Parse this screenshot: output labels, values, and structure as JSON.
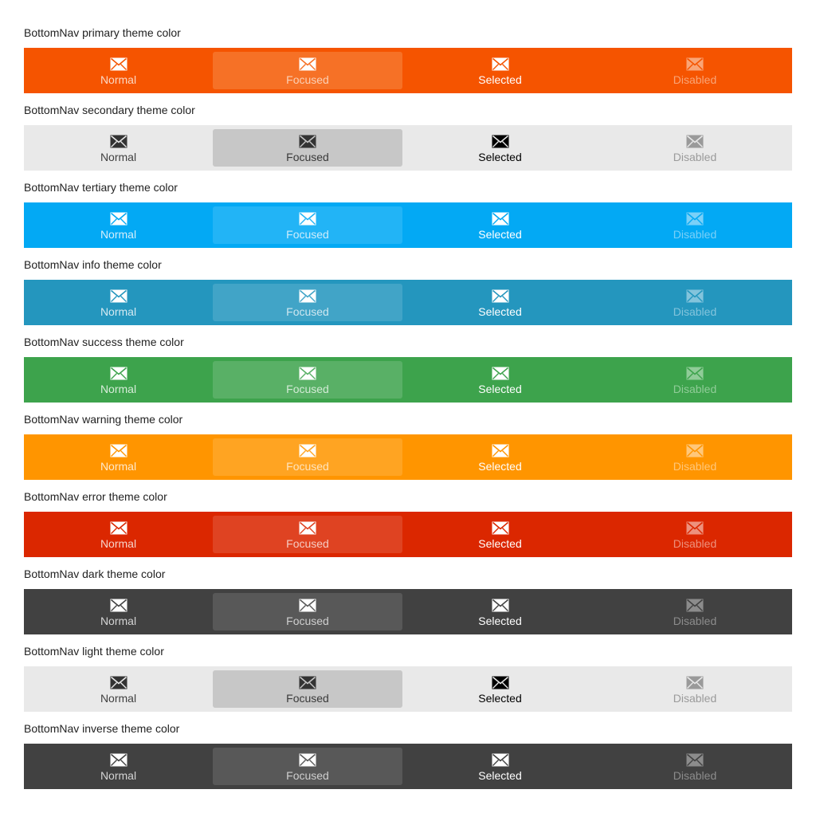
{
  "items": [
    {
      "label": "Normal",
      "state": "normal"
    },
    {
      "label": "Focused",
      "state": "focused"
    },
    {
      "label": "Selected",
      "state": "selected"
    },
    {
      "label": "Disabled",
      "state": "disabled"
    }
  ],
  "icon": "envelope-icon",
  "themes": [
    {
      "key": "primary",
      "title": "BottomNav primary theme color",
      "bg": "#f55400",
      "focus_bg": "#f67126",
      "normal_color": "#fbd8c3",
      "focused_color": "#fbd0b5",
      "selected_color": "#ffffff",
      "disabled_color": "#f9a577",
      "icon_normal": "#ffffff",
      "icon_disabled": "#f9a577"
    },
    {
      "key": "secondary",
      "title": "BottomNav secondary theme color",
      "bg": "#e9e9e9",
      "focus_bg": "#c7c7c7",
      "normal_color": "#404040",
      "focused_color": "#3a3a3a",
      "selected_color": "#000000",
      "disabled_color": "#9a9a9a",
      "icon_normal": "#333333",
      "icon_disabled": "#9a9a9a"
    },
    {
      "key": "tertiary",
      "title": "BottomNav tertiary theme color",
      "bg": "#03a9f4",
      "focus_bg": "#22b4f6",
      "normal_color": "#d4eefb",
      "focused_color": "#cdecfb",
      "selected_color": "#ffffff",
      "disabled_color": "#7ad0f8",
      "icon_normal": "#ffffff",
      "icon_disabled": "#7ad0f8"
    },
    {
      "key": "info",
      "title": "BottomNav info theme color",
      "bg": "#2496be",
      "focus_bg": "#41a4c7",
      "normal_color": "#d4eaf2",
      "focused_color": "#cfe7f0",
      "selected_color": "#ffffff",
      "disabled_color": "#83c4dc",
      "icon_normal": "#ffffff",
      "icon_disabled": "#83c4dc"
    },
    {
      "key": "success",
      "title": "BottomNav success theme color",
      "bg": "#3da34c",
      "focus_bg": "#59b066",
      "normal_color": "#d8edda",
      "focused_color": "#d3ebd6",
      "selected_color": "#ffffff",
      "disabled_color": "#90cc98",
      "icon_normal": "#ffffff",
      "icon_disabled": "#90cc98"
    },
    {
      "key": "warning",
      "title": "BottomNav warning theme color",
      "bg": "#ff9500",
      "focus_bg": "#ffa422",
      "normal_color": "#ffe9cc",
      "focused_color": "#ffe4bd",
      "selected_color": "#ffffff",
      "disabled_color": "#ffc77a",
      "icon_normal": "#ffffff",
      "icon_disabled": "#ffc77a"
    },
    {
      "key": "error",
      "title": "BottomNav error theme color",
      "bg": "#db2700",
      "focus_bg": "#df4322",
      "normal_color": "#f7d3cb",
      "focused_color": "#f5cbc2",
      "selected_color": "#ffffff",
      "disabled_color": "#ed917d",
      "icon_normal": "#ffffff",
      "icon_disabled": "#ed917d"
    },
    {
      "key": "dark",
      "title": "BottomNav dark theme color",
      "bg": "#414141",
      "focus_bg": "#585858",
      "normal_color": "#d4d4d4",
      "focused_color": "#cfcfcf",
      "selected_color": "#ffffff",
      "disabled_color": "#8c8c8c",
      "icon_normal": "#ffffff",
      "icon_disabled": "#8c8c8c"
    },
    {
      "key": "light",
      "title": "BottomNav light theme color",
      "bg": "#e9e9e9",
      "focus_bg": "#c7c7c7",
      "normal_color": "#404040",
      "focused_color": "#3a3a3a",
      "selected_color": "#000000",
      "disabled_color": "#9a9a9a",
      "icon_normal": "#333333",
      "icon_disabled": "#9a9a9a"
    },
    {
      "key": "inverse",
      "title": "BottomNav inverse theme color",
      "bg": "#414141",
      "focus_bg": "#585858",
      "normal_color": "#d4d4d4",
      "focused_color": "#cfcfcf",
      "selected_color": "#ffffff",
      "disabled_color": "#8c8c8c",
      "icon_normal": "#ffffff",
      "icon_disabled": "#8c8c8c"
    }
  ]
}
